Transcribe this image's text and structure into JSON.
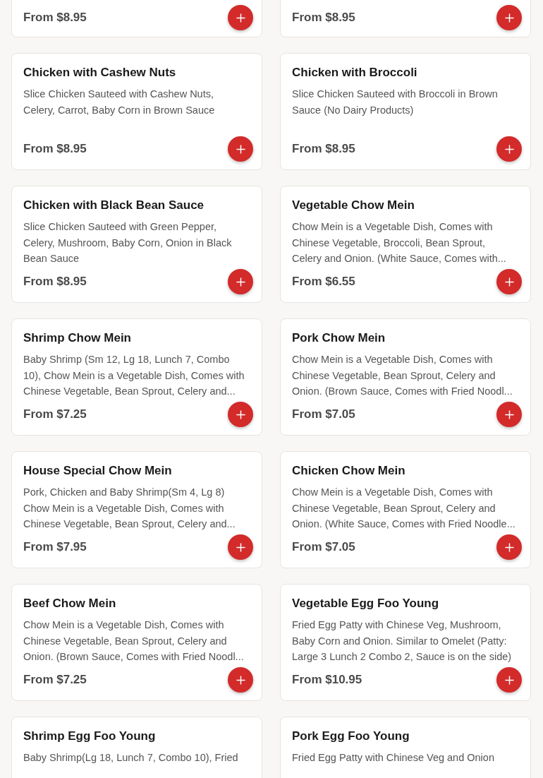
{
  "menu_items": [
    {
      "price": "From $8.95"
    },
    {
      "price": "From $8.95"
    },
    {
      "name": "Chicken with Cashew Nuts",
      "description": "Slice Chicken Sauteed with Cashew Nuts, Celery, Carrot, Baby Corn in Brown Sauce",
      "price": "From $8.95"
    },
    {
      "name": "Chicken with Broccoli",
      "description": "Slice Chicken Sauteed with Broccoli in Brown Sauce (No Dairy Products)",
      "price": "From $8.95"
    },
    {
      "name": "Chicken with Black Bean Sauce",
      "description": "Slice Chicken Sauteed with Green Pepper, Celery, Mushroom, Baby Corn, Onion in Black Bean Sauce",
      "price": "From $8.95"
    },
    {
      "name": "Vegetable Chow Mein",
      "description": "Chow Mein is a Vegetable Dish, Comes with Chinese Vegetable, Broccoli, Bean Sprout, Celery and Onion. (White Sauce, Comes with...",
      "price": "From $6.55"
    },
    {
      "name": "Shrimp Chow Mein",
      "description": "Baby Shrimp (Sm 12, Lg 18, Lunch 7, Combo 10), Chow Mein is a Vegetable Dish, Comes with Chinese Vegetable, Bean Sprout, Celery and...",
      "price": "From $7.25"
    },
    {
      "name": "Pork Chow Mein",
      "description": "Chow Mein is a Vegetable Dish, Comes with Chinese Vegetable, Bean Sprout, Celery and Onion. (Brown Sauce, Comes with Fried Noodl...",
      "price": "From $7.05"
    },
    {
      "name": "House Special Chow Mein",
      "description": "Pork, Chicken and Baby Shrimp(Sm 4, Lg 8) Chow Mein is a Vegetable Dish, Comes with Chinese Vegetable, Bean Sprout, Celery and...",
      "price": "From $7.95"
    },
    {
      "name": "Chicken Chow Mein",
      "description": "Chow Mein is a Vegetable Dish, Comes with Chinese Vegetable, Bean Sprout, Celery and Onion. (White Sauce, Comes with Fried Noodle...",
      "price": "From $7.05"
    },
    {
      "name": "Beef Chow Mein",
      "description": "Chow Mein is a Vegetable Dish, Comes with Chinese Vegetable, Bean Sprout, Celery and Onion. (Brown Sauce, Comes with Fried Noodl...",
      "price": "From $7.25"
    },
    {
      "name": "Vegetable Egg Foo Young",
      "description": "Fried Egg Patty with Chinese Veg, Mushroom, Baby Corn and Onion. Similar to Omelet (Patty: Large 3 Lunch 2 Combo 2, Sauce is on the side)",
      "price": "From $10.95"
    },
    {
      "name": "Shrimp Egg Foo Young",
      "description": "Baby Shrimp(Lg 18, Lunch 7, Combo 10), Fried"
    },
    {
      "name": "Pork Egg Foo Young",
      "description": "Fried Egg Patty with Chinese Veg and Onion"
    }
  ]
}
